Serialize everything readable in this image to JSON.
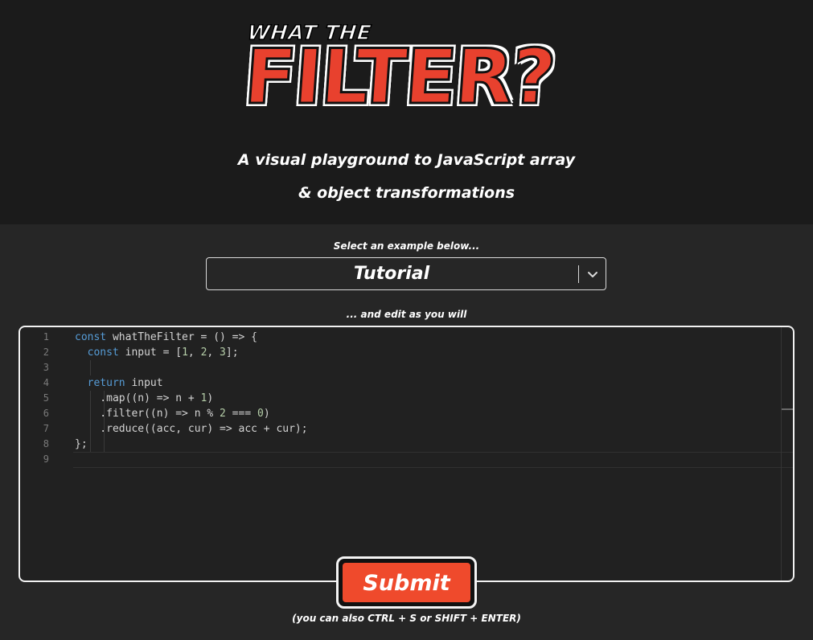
{
  "header": {
    "logo_top": "WHAT THE",
    "logo_main": "FILTER?",
    "tagline_line1": "A visual playground to JavaScript array",
    "tagline_line2": "& object transformations"
  },
  "example_select": {
    "label": "Select an example below...",
    "selected": "Tutorial"
  },
  "editor": {
    "label": "... and edit as you will",
    "line_numbers": [
      "1",
      "2",
      "3",
      "4",
      "5",
      "6",
      "7",
      "8",
      "9"
    ]
  },
  "submit": {
    "label": "Submit",
    "hint": "(you can also CTRL + S or SHIFT + ENTER)"
  },
  "colors": {
    "accent": "#ef4a2c",
    "background": "#262626",
    "header_background": "#1b1b1b"
  }
}
